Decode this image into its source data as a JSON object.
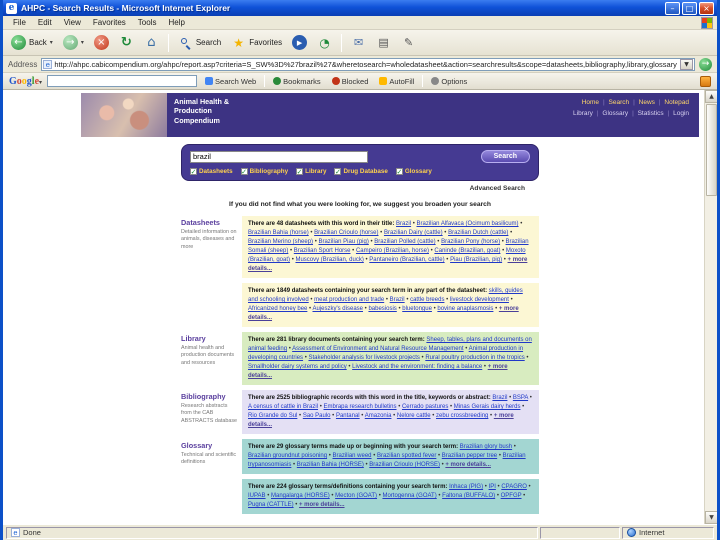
{
  "window": {
    "title": "AHPC - Search Results - Microsoft Internet Explorer",
    "menu": [
      "File",
      "Edit",
      "View",
      "Favorites",
      "Tools",
      "Help"
    ],
    "toolbar": {
      "back_label": "Back",
      "search_label": "Search",
      "favorites_label": "Favorites",
      "icons": [
        "back-icon",
        "forward-icon",
        "stop-icon",
        "refresh-icon",
        "home-icon",
        "search-icon",
        "favorites-icon",
        "media-icon",
        "history-icon",
        "mail-icon",
        "print-icon",
        "edit-icon"
      ]
    },
    "address": {
      "label": "Address",
      "value": "http://ahpc.cabicompendium.org/ahpc/report.asp?criteria=S_SW%3D%27brazil%27&wheretosearch=wholedatasheet&action=searchresults&scope=datasheets,bibliography,library,glossary"
    },
    "google": {
      "brand": "Google",
      "query": "",
      "search_web_label": "Search Web",
      "buttons": [
        "Bookmarks",
        "Blocked",
        "AutoFill",
        "Options"
      ]
    },
    "status": {
      "message": "Done",
      "zone": "Internet"
    }
  },
  "page": {
    "brand_line1": "Animal Health &",
    "brand_line2": "Production",
    "brand_line3": "Compendium",
    "nav_top": [
      "Home",
      "Search",
      "News",
      "Notepad"
    ],
    "nav_bottom": [
      "Library",
      "Glossary",
      "Statistics",
      "Login"
    ],
    "search_panel": {
      "query": "brazil",
      "checkboxes": [
        {
          "label": "Datasheets"
        },
        {
          "label": "Bibliography"
        },
        {
          "label": "Library"
        },
        {
          "label": "Drug Database"
        },
        {
          "label": "Glossary"
        }
      ],
      "search_button": "Search",
      "advanced_link": "Advanced Search"
    },
    "suggestion": "If you did not find what you were looking for, we suggest you broaden your search",
    "sections": {
      "datasheets": {
        "label": "Datasheets",
        "description": "Detailed information on animals, diseases and more",
        "blocks": [
          {
            "intro": "There are 48 datasheets with this word in their title:",
            "links": [
              "Brazil",
              "Brazilian Alfavaca (Ocimum basilicum)",
              "Brazilian Bahia (horse)",
              "Brazilian Crioulo (horse)",
              "Brazilian Dairy (cattle)",
              "Brazilian Dutch (cattle)",
              "Brazilian Merino (sheep)",
              "Brazilian Piau (pig)",
              "Brazilian Polled (cattle)",
              "Brazilian Pony (horse)",
              "Brazilian Somali (sheep)",
              "Brazilian Sport Horse",
              "Campeiro (Brazilian, horse)",
              "Caninde (Brazilian, goat)",
              "Moxoto (Brazilian, goat)",
              "Muscovy (Brazilian, duck)",
              "Pantaneiro (Brazilian, cattle)",
              "Piau (Brazilian, pig)"
            ],
            "more": "+ more details..."
          },
          {
            "intro": "There are 1849 datasheets containing your search term in any part of the datasheet:",
            "links": [
              "skills, guides and schooling involved",
              "meat production and trade",
              "Brazil",
              "cattle breeds",
              "livestock development",
              "Africanized honey bee",
              "Aujeszky's disease",
              "babesiosis",
              "bluetongue",
              "bovine anaplasmosis"
            ],
            "more": "+ more details..."
          }
        ]
      },
      "library": {
        "label": "Library",
        "description": "Animal health and production documents and resources",
        "blocks": [
          {
            "intro": "There are 281 library documents containing your search term:",
            "links": [
              "Sheep, tables, plans and documents on animal feeding",
              "Assessment of Environment and Natural Resource Management",
              "Animal production in developing countries",
              "Stakeholder analysis for livestock projects",
              "Rural poultry production in the tropics",
              "Smallholder dairy systems and policy",
              "Livestock and the environment: finding a balance"
            ],
            "more": "+ more details..."
          }
        ]
      },
      "bibliography": {
        "label": "Bibliography",
        "description": "Research abstracts from the CAB ABSTRACTS database",
        "blocks": [
          {
            "intro": "There are 2525 bibliographic records with this word in the title, keywords or abstract:",
            "links": [
              "Brazil",
              "BSPA",
              "A census of cattle in Brazil",
              "Embrapa research bulletins",
              "Cerrado pastures",
              "Minas Gerais dairy herds",
              "Rio Grande do Sul",
              "Sao Paulo",
              "Pantanal",
              "Amazonia",
              "Nelore cattle",
              "zebu crossbreeding"
            ],
            "more": "+ more details..."
          }
        ]
      },
      "glossary": {
        "label": "Glossary",
        "description": "Technical and scientific definitions",
        "blocks": [
          {
            "intro": "There are 29 glossary terms made up or beginning with your search term:",
            "links": [
              "Brazilian glory bush",
              "Brazilian groundnut poisoning",
              "Brazilian weed",
              "Brazilian spotted fever",
              "Brazilian pepper tree",
              "Brazilian trypanosomiasis",
              "Brazilian Bahia (HORSE)",
              "Brazilian Crioulo (HORSE)"
            ],
            "more": "+ more details..."
          },
          {
            "intro": "There are 224 glossary terms/definitions containing your search term:",
            "links": [
              "Inhaca (PIG)",
              "IPI",
              "CPAGRO",
              "IUPAB",
              "Mangalarga (HORSE)",
              "Mecton (GOAT)",
              "Mortogenna (GOAT)",
              "Faltona (BUFFALO)",
              "OPFGP",
              "Pugna (CATTLE)"
            ],
            "more": "+ more details..."
          }
        ]
      }
    }
  }
}
